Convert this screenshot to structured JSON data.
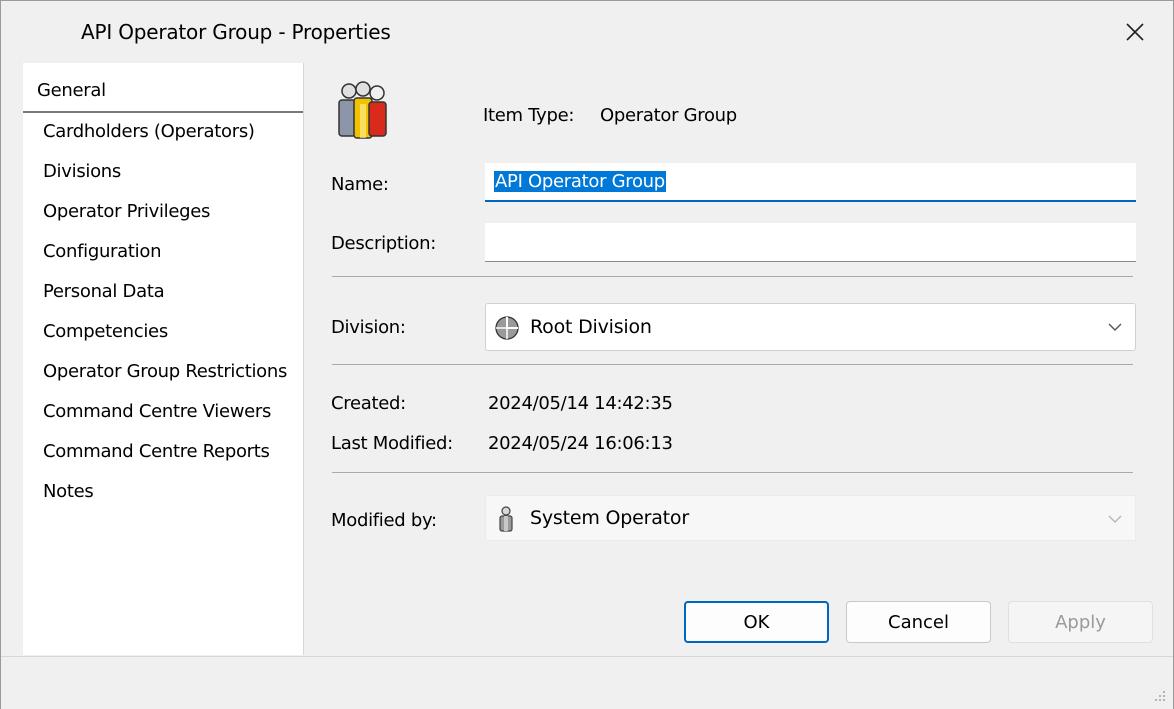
{
  "window": {
    "title": "API Operator Group - Properties"
  },
  "nav": {
    "items": [
      {
        "label": "General",
        "selected": true
      },
      {
        "label": "Cardholders (Operators)"
      },
      {
        "label": "Divisions"
      },
      {
        "label": "Operator Privileges"
      },
      {
        "label": "Configuration"
      },
      {
        "label": "Personal Data"
      },
      {
        "label": "Competencies"
      },
      {
        "label": "Operator Group Restrictions"
      },
      {
        "label": "Command Centre Viewers"
      },
      {
        "label": "Command Centre Reports"
      },
      {
        "label": "Notes"
      }
    ]
  },
  "general": {
    "item_type_label": "Item Type:",
    "item_type_value": "Operator Group",
    "name_label": "Name:",
    "name_value": "API Operator Group",
    "description_label": "Description:",
    "description_value": "",
    "division_label": "Division:",
    "division_value": "Root Division",
    "created_label": "Created:",
    "created_value": "2024/05/14 14:42:35",
    "last_modified_label": "Last Modified:",
    "last_modified_value": "2024/05/24 16:06:13",
    "modified_by_label": "Modified by:",
    "modified_by_value": "System Operator"
  },
  "buttons": {
    "ok": "OK",
    "cancel": "Cancel",
    "apply": "Apply"
  },
  "colors": {
    "accent": "#0067c0",
    "selection": "#0078d7"
  }
}
